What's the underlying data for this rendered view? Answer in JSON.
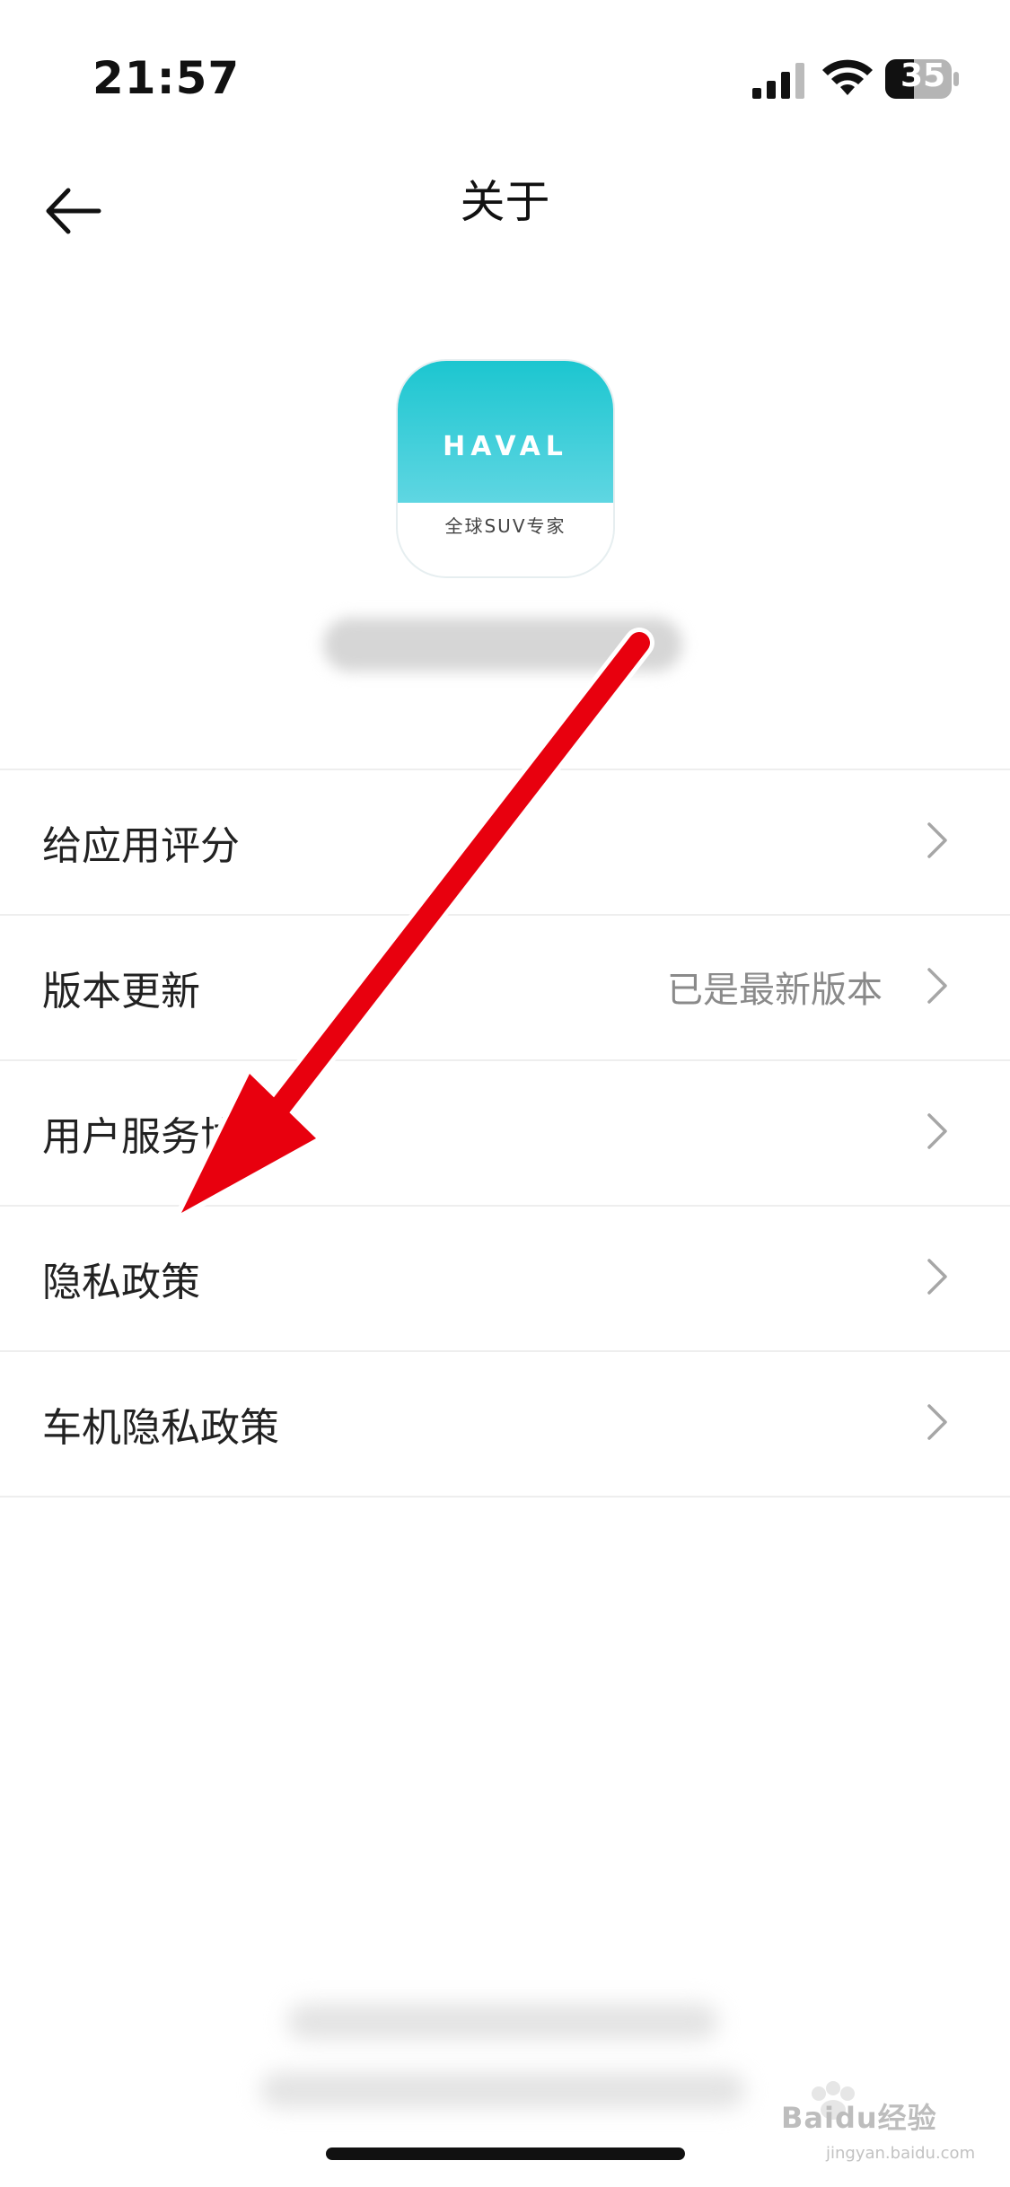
{
  "status_bar": {
    "time": "21:57",
    "battery_level": "35"
  },
  "nav": {
    "title": "关于"
  },
  "app": {
    "brand": "HAVAL",
    "slogan": "全球SUV专家"
  },
  "menu": {
    "items": [
      {
        "label": "给应用评分",
        "value": ""
      },
      {
        "label": "版本更新",
        "value": "已是最新版本"
      },
      {
        "label": "用户服务协议",
        "value": ""
      },
      {
        "label": "隐私政策",
        "value": ""
      },
      {
        "label": "车机隐私政策",
        "value": ""
      }
    ]
  },
  "watermark": {
    "brand": "Baidu经验",
    "url": "jingyan.baidu.com"
  },
  "colors": {
    "accent": "#1cc6d0",
    "arrow": "#e8000e"
  }
}
